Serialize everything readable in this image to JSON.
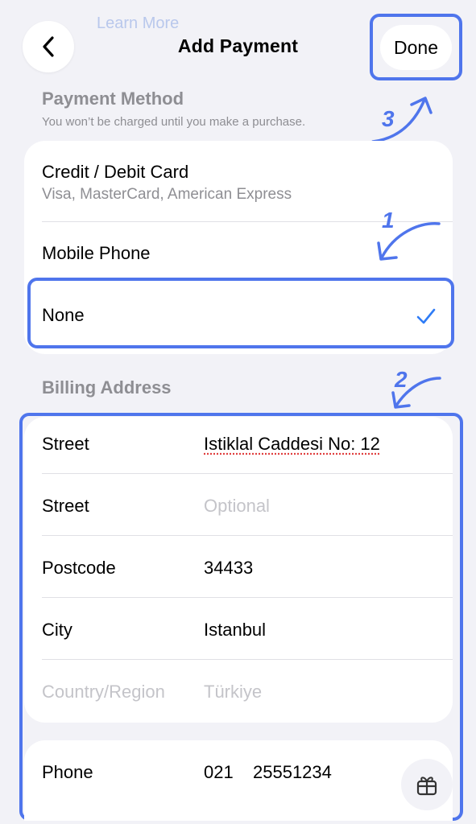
{
  "header": {
    "faded_text": "Learn More",
    "title": "Add Payment",
    "done_label": "Done"
  },
  "payment_method": {
    "title": "Payment Method",
    "subtitle": "You won’t be charged until you make a purchase.",
    "options": [
      {
        "label": "Credit / Debit Card",
        "sub": "Visa, MasterCard, American Express"
      },
      {
        "label": "Mobile Phone"
      },
      {
        "label": "None",
        "selected": true
      }
    ]
  },
  "billing": {
    "title": "Billing Address",
    "fields": [
      {
        "label": "Street",
        "value": "Istiklal Caddesi No: 12"
      },
      {
        "label": "Street",
        "placeholder": "Optional"
      },
      {
        "label": "Postcode",
        "value": "34433"
      },
      {
        "label": "City",
        "value": "Istanbul"
      },
      {
        "label": "Country/Region",
        "value": "Türkiye"
      }
    ],
    "phone": {
      "label": "Phone",
      "area": "021",
      "number": "25551234"
    }
  },
  "annotations": {
    "step1": "1",
    "step2": "2",
    "step3": "3",
    "color": "#4f75ec"
  }
}
